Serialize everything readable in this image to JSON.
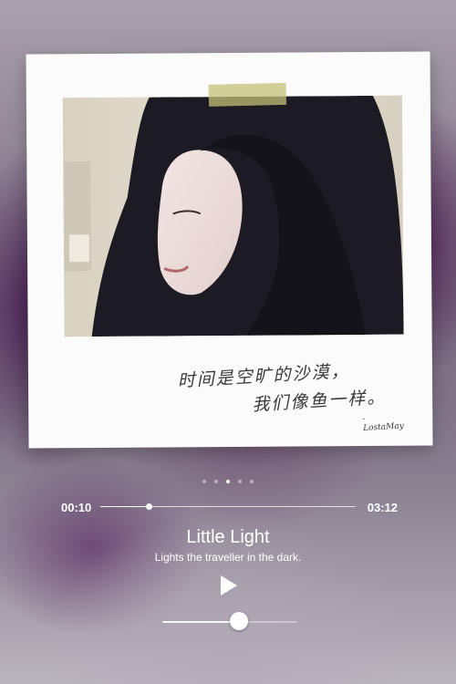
{
  "card": {
    "caption_line1": "时间是空旷的沙漠，",
    "caption_line2": "我们像鱼一样。",
    "caption_signature": "- LostaMay"
  },
  "pager": {
    "count": 5,
    "active_index": 2
  },
  "player": {
    "current_time": "00:10",
    "total_time": "03:12",
    "progress_fraction": 0.19,
    "song_title": "Little Light",
    "song_subtitle": "Lights the traveller in the dark.",
    "play_icon": "play-icon",
    "volume_fraction": 0.57
  },
  "colors": {
    "text": "#ffffff",
    "card": "#fbfbfb",
    "tape": "#c4c078"
  }
}
